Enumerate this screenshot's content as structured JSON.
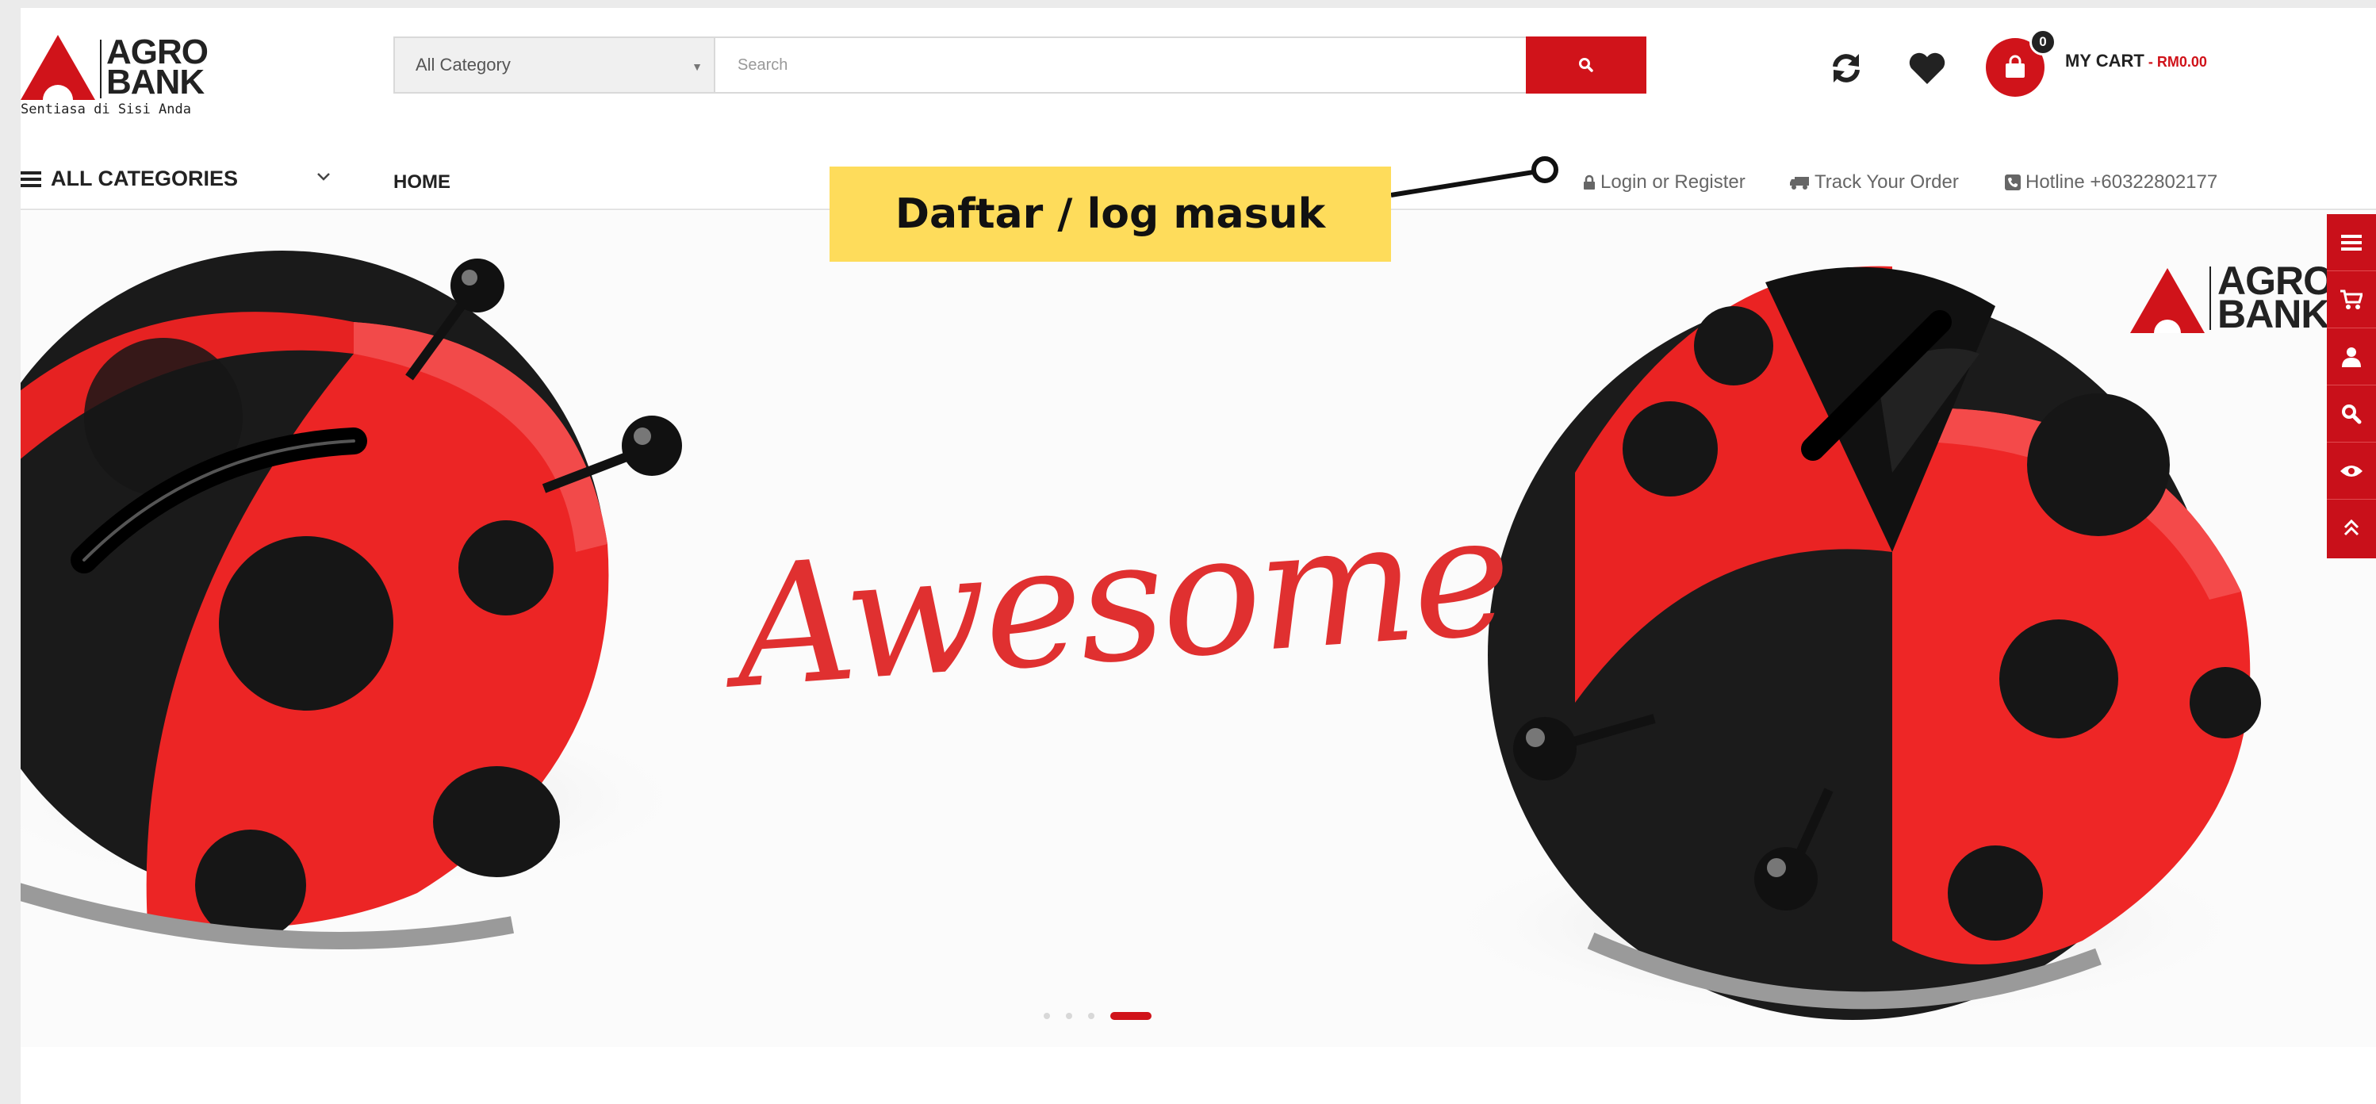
{
  "logo": {
    "line1": "AGRO",
    "line2": "BANK",
    "tagline": "Sentiasa di Sisi Anda",
    "brand_color": "#d0131a"
  },
  "search": {
    "category": "All Category",
    "placeholder": "Search",
    "button_icon": "search-icon"
  },
  "header": {
    "refresh_icon": "refresh-icon",
    "wishlist_icon": "heart-icon",
    "cart_count": "0",
    "cart_label": "MY CART",
    "cart_amount": " - RM0.00"
  },
  "nav": {
    "all_categories": "ALL CATEGORIES",
    "home": "HOME",
    "login": "Login or Register",
    "track": "Track Your Order",
    "hotline": "Hotline +60322802177"
  },
  "annotation": {
    "text": "Daftar / log masuk"
  },
  "hero": {
    "script_text": "Awesome",
    "logo_line1": "AGRO",
    "logo_line2": "BANK",
    "slides_total": 4,
    "active_slide": 4
  },
  "sidebar": {
    "icons": [
      "menu-icon",
      "cart-icon",
      "user-icon",
      "search-icon",
      "eye-icon",
      "arrow-up-icon"
    ]
  }
}
